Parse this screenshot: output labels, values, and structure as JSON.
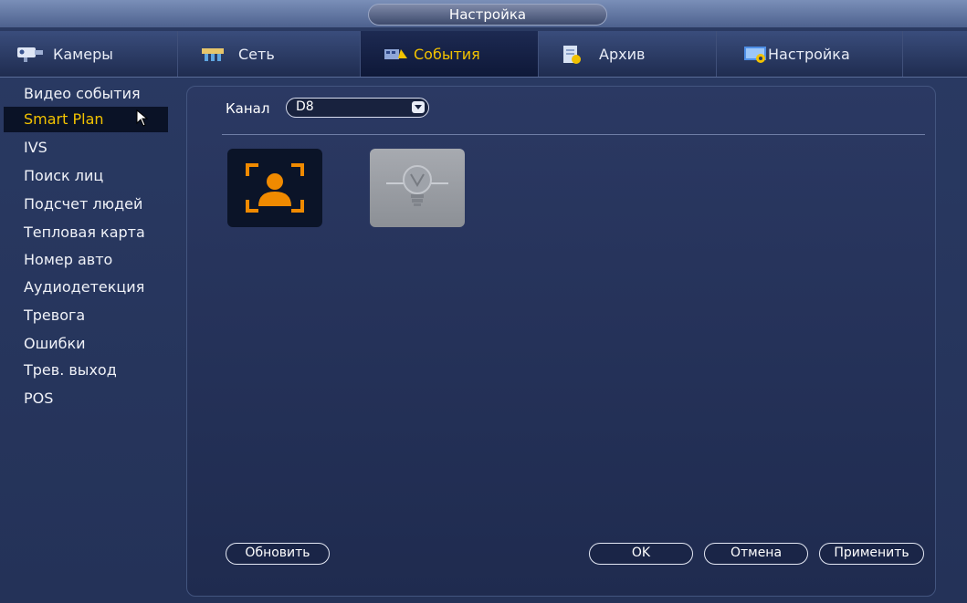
{
  "window": {
    "title": "Настройка"
  },
  "tabs": [
    {
      "label": "Камеры",
      "icon": "camera-icon",
      "active": false
    },
    {
      "label": "Сеть",
      "icon": "network-icon",
      "active": false
    },
    {
      "label": "События",
      "icon": "events-icon",
      "active": true
    },
    {
      "label": "Архив",
      "icon": "archive-icon",
      "active": false
    },
    {
      "label": "Настройка",
      "icon": "settings-icon",
      "active": false
    }
  ],
  "sidebar": {
    "items": [
      {
        "label": "Видео события"
      },
      {
        "label": "Smart Plan",
        "active": true
      },
      {
        "label": "IVS"
      },
      {
        "label": "Поиск лиц"
      },
      {
        "label": "Подсчет людей"
      },
      {
        "label": "Тепловая карта"
      },
      {
        "label": "Номер авто"
      },
      {
        "label": "Аудиодетекция"
      },
      {
        "label": "Тревога"
      },
      {
        "label": "Ошибки"
      },
      {
        "label": "Трев. выход"
      },
      {
        "label": "POS"
      }
    ]
  },
  "main": {
    "channel_label": "Канал",
    "channel_value": "D8",
    "plans": [
      {
        "icon": "face-detection-icon",
        "state": "enabled"
      },
      {
        "icon": "lightbulb-icon",
        "state": "disabled"
      }
    ]
  },
  "buttons": {
    "refresh": "Обновить",
    "ok": "OK",
    "cancel": "Отмена",
    "apply": "Применить"
  },
  "colors": {
    "accent": "#f2c200",
    "face_icon": "#f08a00",
    "panel": "#243258"
  }
}
